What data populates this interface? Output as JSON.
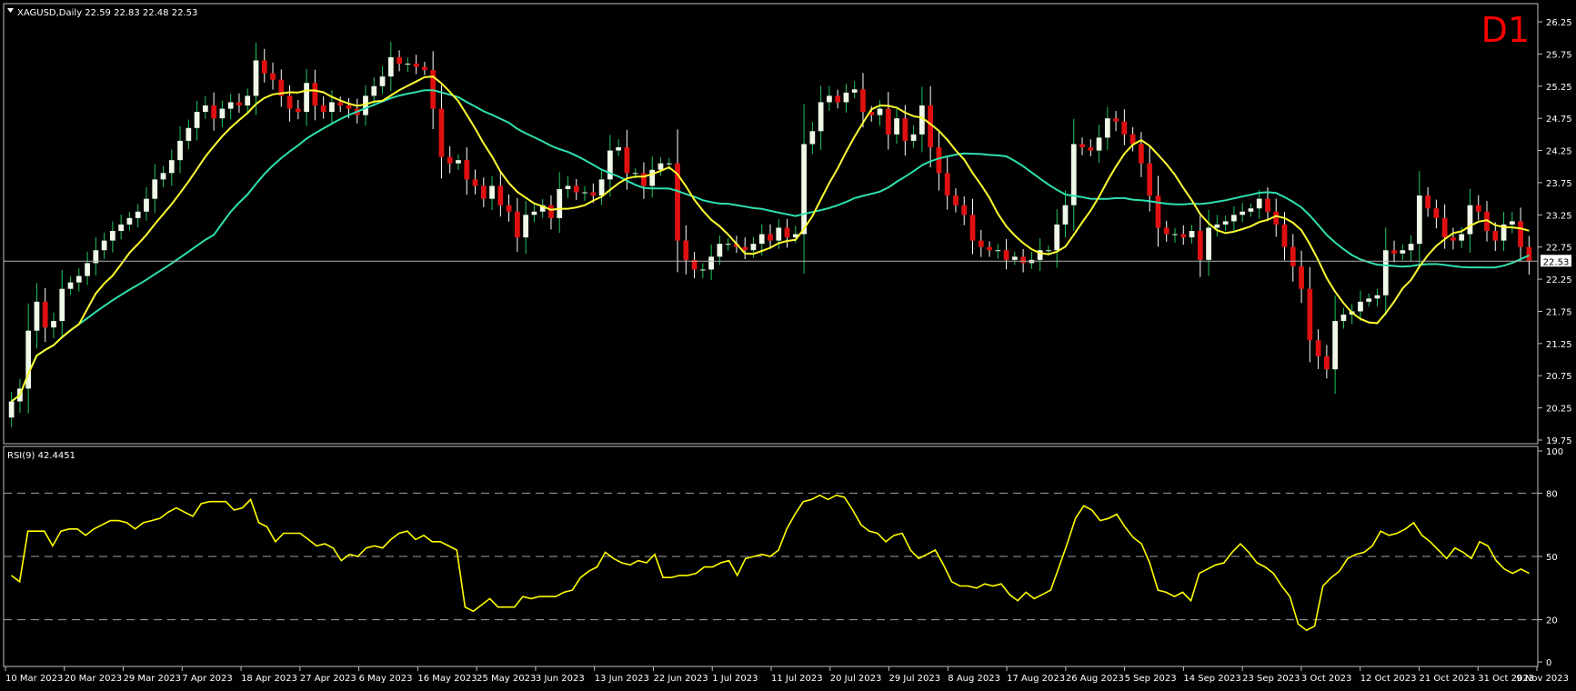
{
  "symbol_header": "XAGUSD,Daily  22.59 22.83 22.48 22.53",
  "timeframe_label": "D1",
  "current_price_label": "22.53",
  "colors": {
    "background": "#000000",
    "frame": "#c0c0c0",
    "bull_candle": "#f0f8e8",
    "bear_candle": "#e01010",
    "wick_bull": "#22c55e",
    "wick_bear": "#ffffff",
    "ma_fast": "#ffff33",
    "ma_slow": "#2fe0b0",
    "rsi_line": "#ffff00",
    "timeframe_label": "#ff0000",
    "text": "#ffffff"
  },
  "chart_data": [
    {
      "type": "candlestick",
      "title": "XAGUSD,Daily",
      "ohlc_last": {
        "open": 22.59,
        "high": 22.83,
        "low": 22.48,
        "close": 22.53
      },
      "ylim": [
        19.75,
        26.25
      ],
      "y_ticks": [
        "26.25",
        "25.75",
        "25.25",
        "24.75",
        "24.25",
        "23.75",
        "23.25",
        "22.75",
        "22.25",
        "21.75",
        "21.25",
        "20.75",
        "20.25",
        "19.75"
      ],
      "x_ticks": [
        "10 Mar 2023",
        "20 Mar 2023",
        "29 Mar 2023",
        "7 Apr 2023",
        "18 Apr 2023",
        "27 Apr 2023",
        "6 May 2023",
        "16 May 2023",
        "25 May 2023",
        "3 Jun 2023",
        "13 Jun 2023",
        "22 Jun 2023",
        "1 Jul 2023",
        "11 Jul 2023",
        "20 Jul 2023",
        "29 Jul 2023",
        "8 Aug 2023",
        "17 Aug 2023",
        "26 Aug 2023",
        "5 Sep 2023",
        "14 Sep 2023",
        "23 Sep 2023",
        "3 Oct 2023",
        "12 Oct 2023",
        "21 Oct 2023",
        "31 Oct 2023",
        "9 Nov 2023"
      ],
      "close": [
        20.35,
        20.55,
        21.45,
        21.9,
        21.5,
        21.6,
        22.1,
        22.2,
        22.3,
        22.5,
        22.7,
        22.85,
        23.0,
        23.1,
        23.2,
        23.3,
        23.5,
        23.8,
        23.9,
        24.1,
        24.4,
        24.6,
        24.85,
        24.95,
        24.75,
        24.9,
        25.0,
        24.95,
        25.1,
        25.65,
        25.45,
        25.35,
        25.1,
        24.9,
        24.85,
        25.3,
        24.95,
        24.85,
        25.0,
        24.95,
        24.9,
        24.8,
        25.1,
        25.25,
        25.4,
        25.7,
        25.6,
        25.6,
        25.55,
        25.5,
        24.9,
        24.15,
        24.05,
        24.1,
        23.8,
        23.7,
        23.5,
        23.7,
        23.4,
        23.3,
        22.9,
        23.25,
        23.3,
        23.4,
        23.2,
        23.65,
        23.7,
        23.6,
        23.6,
        23.55,
        23.8,
        24.25,
        24.3,
        23.9,
        23.9,
        23.7,
        23.95,
        24.05,
        24.05,
        22.85,
        22.55,
        22.4,
        22.4,
        22.6,
        22.8,
        22.8,
        22.75,
        22.7,
        22.8,
        22.95,
        22.85,
        23.05,
        22.9,
        22.95,
        24.35,
        24.55,
        25.0,
        25.1,
        25.0,
        25.15,
        25.2,
        24.85,
        24.8,
        24.9,
        24.5,
        24.75,
        24.4,
        24.5,
        24.95,
        24.3,
        23.9,
        23.55,
        23.4,
        23.25,
        22.85,
        22.75,
        22.7,
        22.7,
        22.55,
        22.6,
        22.5,
        22.55,
        22.7,
        22.7,
        23.1,
        23.4,
        24.35,
        24.3,
        24.25,
        24.45,
        24.75,
        24.7,
        24.5,
        24.35,
        24.05,
        23.55,
        23.05,
        22.95,
        22.95,
        22.9,
        23.0,
        22.55,
        23.05,
        23.1,
        23.15,
        23.25,
        23.3,
        23.35,
        23.5,
        23.3,
        23.1,
        22.75,
        22.45,
        22.1,
        21.3,
        21.05,
        20.85,
        21.6,
        21.7,
        21.75,
        21.9,
        21.95,
        22.0,
        22.7,
        22.65,
        22.7,
        22.8,
        23.55,
        23.35,
        23.2,
        22.9,
        22.85,
        22.95,
        23.4,
        23.3,
        23.0,
        22.85,
        23.1,
        23.15,
        22.75,
        22.53
      ]
    },
    {
      "type": "line",
      "title": "RSI(9) 42.4451",
      "ylim": [
        0,
        100
      ],
      "y_ticks": [
        "100",
        "80",
        "50",
        "20",
        "0"
      ],
      "levels": [
        80,
        50,
        20
      ],
      "values": [
        41,
        38,
        62,
        62,
        62,
        55,
        62,
        63,
        63,
        60,
        63,
        65,
        67,
        67,
        66,
        63,
        66,
        67,
        68,
        71,
        73,
        71,
        69,
        75,
        76,
        76,
        76,
        72,
        73,
        77,
        66,
        64,
        57,
        61,
        61,
        61,
        58,
        55,
        56,
        54,
        48,
        51,
        50,
        54,
        55,
        54,
        58,
        61,
        62,
        58,
        60,
        57,
        57,
        55,
        53,
        26,
        24,
        27,
        30,
        26,
        26,
        26,
        31,
        30,
        31,
        31,
        31,
        33,
        34,
        40,
        43,
        45,
        52,
        49,
        47,
        46,
        48,
        47,
        51,
        40,
        40,
        41,
        41,
        42,
        45,
        45,
        47,
        48,
        41,
        49,
        50,
        51,
        50,
        53,
        63,
        70,
        76,
        77,
        79,
        77,
        79,
        78,
        72,
        65,
        62,
        61,
        57,
        60,
        61,
        53,
        49,
        51,
        53,
        46,
        38,
        36,
        36,
        35,
        37,
        36,
        37,
        32,
        29,
        33,
        30,
        32,
        34,
        45,
        56,
        68,
        74,
        72,
        67,
        68,
        70,
        64,
        59,
        56,
        47,
        34,
        33,
        31,
        33,
        29,
        42,
        44,
        46,
        47,
        52,
        56,
        52,
        47,
        45,
        42,
        36,
        31,
        18,
        15,
        17,
        36,
        40,
        43,
        49,
        51,
        52,
        55,
        62,
        60,
        61,
        63,
        66,
        60,
        57,
        53,
        49,
        54,
        52,
        49,
        57,
        55,
        48,
        44,
        42,
        44,
        42
      ]
    }
  ]
}
